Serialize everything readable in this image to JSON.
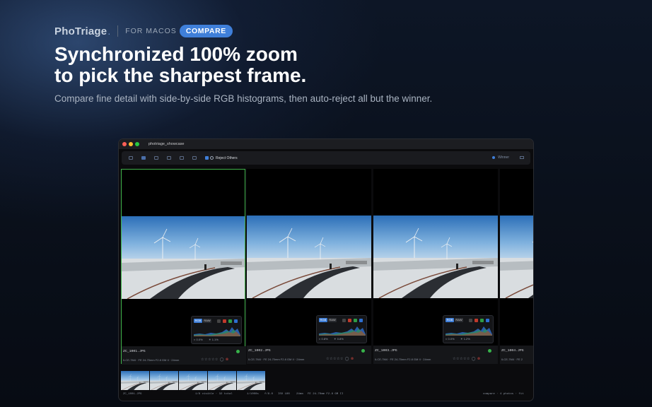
{
  "header": {
    "brand": "PhoTriage",
    "brand_dot": ".",
    "platform": "FOR MACOS",
    "badge": "COMPARE",
    "headline_line1": "Synchronized 100% zoom",
    "headline_line2": "to pick the sharpest frame.",
    "subtitle": "Compare fine detail with side-by-side RGB histograms, then auto-reject all but the winner."
  },
  "window": {
    "title": "photriage_showcase"
  },
  "toolbar": {
    "reject_label": "Reject Others",
    "winner_label": "Winner"
  },
  "panels": [
    {
      "filename": "ZC_1001.JPG",
      "meta": "ILCE-7M4 · FE 24-70mm F2.8 GM II · 24mm",
      "stat1": "0.0%",
      "stat2": "1.1%",
      "rgb": "RGB",
      "raw": "RAW",
      "stars": "☆☆☆☆☆",
      "flag_ok": "◯",
      "flag_x": "⊗"
    },
    {
      "filename": "ZC_1002.JPG",
      "meta": "ILCE-7M4 · FE 24-70mm F2.8 GM II · 24mm",
      "stat1": "0.8%",
      "stat2": "0.8%",
      "rgb": "RGB",
      "raw": "RAW",
      "stars": "☆☆☆☆☆",
      "flag_ok": "◯",
      "flag_x": "⊗"
    },
    {
      "filename": "ZC_1003.JPG",
      "meta": "ILCE-7M4 · FE 24-70mm F2.8 GM II · 24mm",
      "stat1": "0.0%",
      "stat2": "1.2%",
      "rgb": "RGB",
      "raw": "RAW",
      "stars": "☆☆☆☆☆",
      "flag_ok": "◯",
      "flag_x": "⊗"
    },
    {
      "filename": "ZC_1004.JPG",
      "meta": "ILCE-7M4 · FE 2",
      "stars": ""
    }
  ],
  "status": {
    "filename": "ZC_1001.JPG",
    "counts": "1/6 visible · 32 total",
    "shutter": "1/1000s",
    "aperture": "f/8.0",
    "iso": "ISO 100",
    "focal": "24mm",
    "lens": "FE 24-70mm F2.8 GM II",
    "mode": "compare · 4 photos · fit"
  },
  "colors": {
    "accent": "#3f7fd9",
    "selected": "#3fb24a",
    "reject": "#d0463f"
  }
}
